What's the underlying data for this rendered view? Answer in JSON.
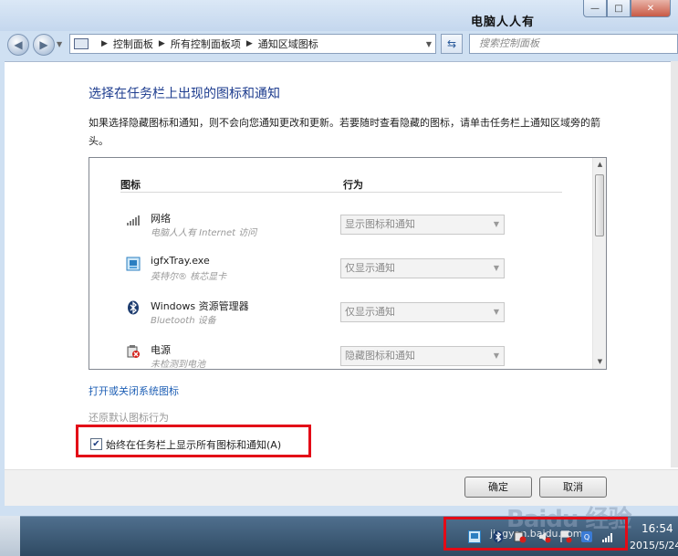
{
  "window": {
    "watermark_title": "电脑人人有",
    "minimize": "—",
    "maximize": "□",
    "close": "✕"
  },
  "navbar": {
    "breadcrumb": [
      "控制面板",
      "所有控制面板项",
      "通知区域图标"
    ],
    "search_placeholder": "搜索控制面板"
  },
  "page": {
    "title": "选择在任务栏上出现的图标和通知",
    "description": "如果选择隐藏图标和通知，则不会向您通知更改和更新。若要随时查看隐藏的图标，请单击任务栏上通知区域旁的箭头。",
    "col_icon": "图标",
    "col_behavior": "行为",
    "rows": [
      {
        "name": "网络",
        "sub": "电脑人人有 Internet 访问",
        "behavior": "显示图标和通知",
        "icon": "network-icon"
      },
      {
        "name": "igfxTray.exe",
        "sub": "英特尔® 核芯显卡",
        "behavior": "仅显示通知",
        "icon": "intel-graphics-icon"
      },
      {
        "name": "Windows 资源管理器",
        "sub": "Bluetooth 设备",
        "behavior": "仅显示通知",
        "icon": "bluetooth-icon"
      },
      {
        "name": "电源",
        "sub": "未检测到电池",
        "behavior": "隐藏图标和通知",
        "icon": "power-icon"
      }
    ],
    "link_system_icons": "打开或关闭系统图标",
    "restore_default": "还原默认图标行为",
    "always_show_label": "始终在任务栏上显示所有图标和通知(A)",
    "always_show_checked": true,
    "ok_label": "确定",
    "cancel_label": "取消"
  },
  "taskbar": {
    "time": "16:54",
    "date": "2015/5/24",
    "watermark": "Baidu 经验",
    "watermark_url": "jingyan.baidu.com"
  }
}
